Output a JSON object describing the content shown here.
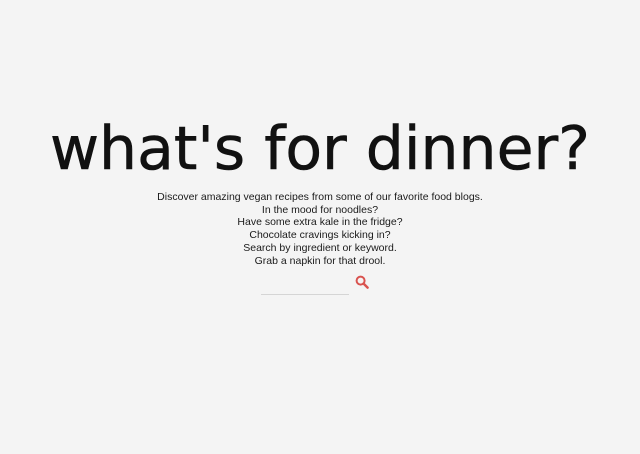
{
  "hero": {
    "title": "what's for dinner?",
    "taglines": [
      "Discover amazing vegan recipes from some of our favorite food blogs.",
      "In the mood for noodles?",
      "Have some extra kale in the fridge?",
      "Chocolate cravings kicking in?",
      "Search by ingredient or keyword.",
      "Grab a napkin for that drool."
    ]
  },
  "search": {
    "value": "",
    "placeholder": "",
    "icon": "search-icon",
    "icon_color": "#d9534f"
  }
}
